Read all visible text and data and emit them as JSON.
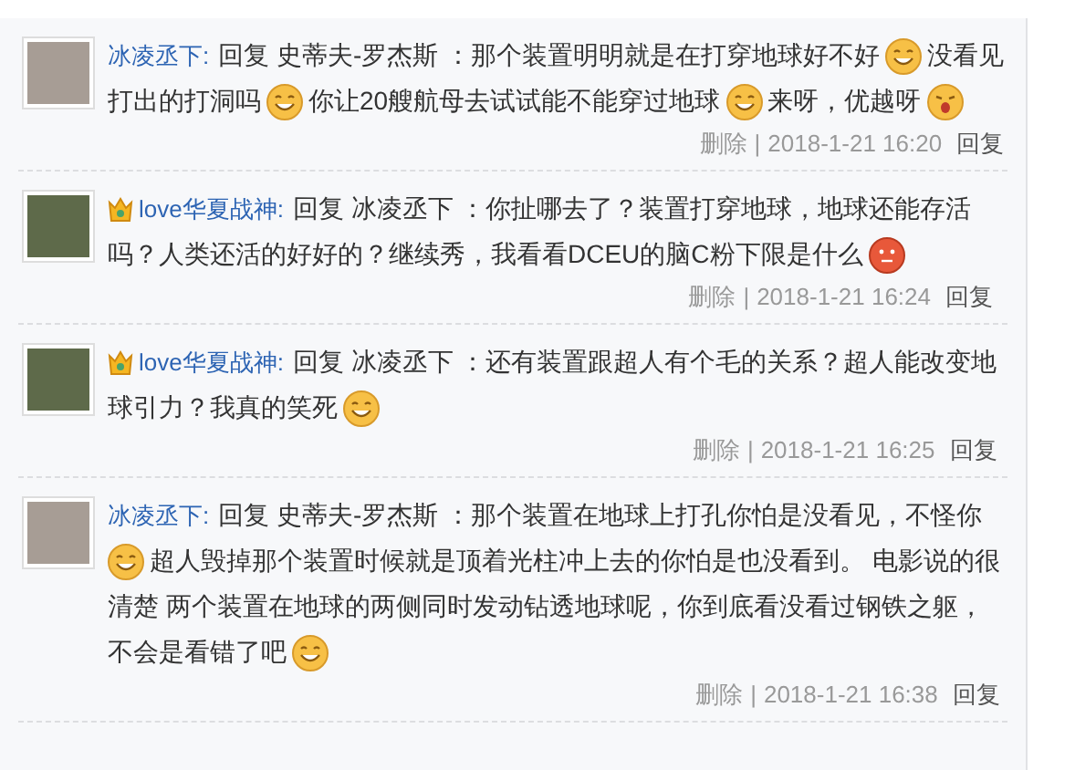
{
  "comments": [
    {
      "author": "冰凌丞下:",
      "vip": false,
      "lines": [
        [
          {
            "kind": "text",
            "text": "回复 史蒂夫-罗杰斯 ：那个装置明明就是在打穿地球好不好"
          },
          {
            "kind": "smile"
          },
          {
            "kind": "text",
            "text": "没看见"
          }
        ],
        [
          {
            "kind": "text",
            "text": "打出的打洞吗"
          },
          {
            "kind": "smile"
          },
          {
            "kind": "text",
            "text": "你让20艘航母去试试能不能穿过地球"
          },
          {
            "kind": "smile"
          },
          {
            "kind": "text",
            "text": "来呀，优越呀"
          },
          {
            "kind": "yawn"
          }
        ]
      ],
      "delete": "删除",
      "separator": "|",
      "time": "2018-1-21 16:20",
      "reply": "回复"
    },
    {
      "author": "love华夏战神:",
      "vip": true,
      "lines": [
        [
          {
            "kind": "text",
            "text": "回复 冰凌丞下 ：你扯哪去了？装置打穿地球，地球还能存活"
          }
        ],
        [
          {
            "kind": "text",
            "text": "吗？人类还活的好好的？继续秀，我看看DCEU的脑C粉下限是什么"
          },
          {
            "kind": "angry"
          }
        ]
      ],
      "delete": "删除",
      "separator": "|",
      "time": "2018-1-21 16:24",
      "reply": "回复"
    },
    {
      "author": "love华夏战神:",
      "vip": true,
      "lines": [
        [
          {
            "kind": "text",
            "text": "回复 冰凌丞下 ：还有装置跟超人有个毛的关系？超人能改变地"
          }
        ],
        [
          {
            "kind": "text",
            "text": "球引力？我真的笑死"
          },
          {
            "kind": "smile"
          }
        ]
      ],
      "delete": "删除",
      "separator": "|",
      "time": "2018-1-21 16:25",
      "reply": "回复"
    },
    {
      "author": "冰凌丞下:",
      "vip": false,
      "lines": [
        [
          {
            "kind": "text",
            "text": "回复 史蒂夫-罗杰斯 ：那个装置在地球上打孔你怕是没看见，不怪你"
          }
        ],
        [
          {
            "kind": "smile"
          },
          {
            "kind": "text",
            "text": "超人毁掉那个装置时候就是顶着光柱冲上去的你怕是也没看到。 电影说的很"
          }
        ],
        [
          {
            "kind": "text",
            "text": "清楚 两个装置在地球的两侧同时发动钻透地球呢，你到底看没看过钢铁之躯，"
          }
        ],
        [
          {
            "kind": "text",
            "text": "不会是看错了吧"
          },
          {
            "kind": "smile"
          }
        ]
      ],
      "delete": "删除",
      "separator": "|",
      "time": "2018-1-21 16:38",
      "reply": "回复"
    }
  ]
}
